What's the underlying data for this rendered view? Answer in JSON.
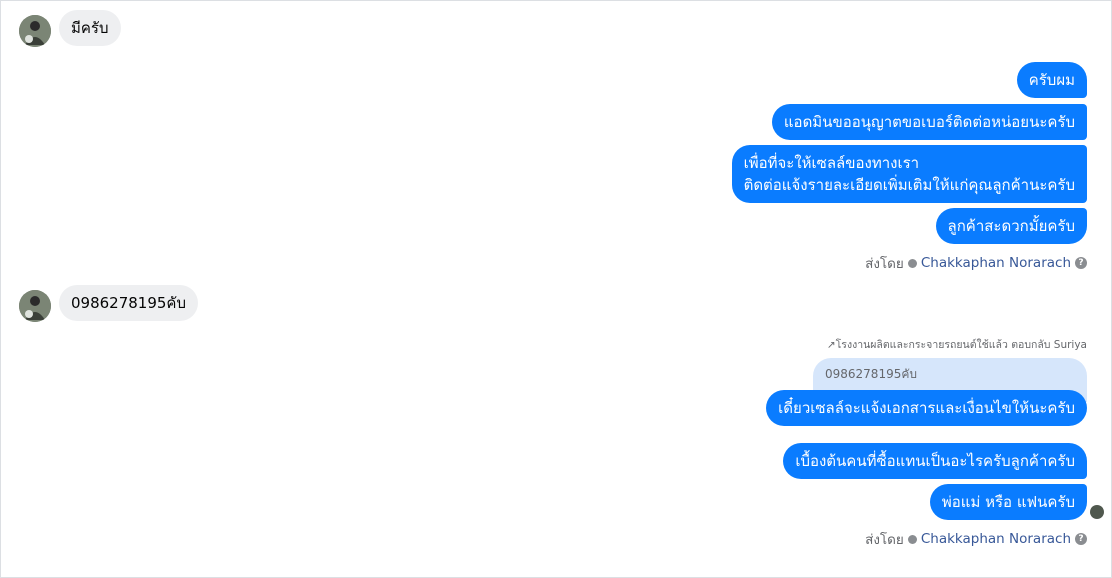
{
  "messages": {
    "incoming_1": "มีครับ",
    "outgoing_group_1": [
      "ครับผม",
      "แอดมินขออนุญาตขอเบอร์ติดต่อหน่อยนะครับ",
      "เพื่อที่จะให้เซลล์ของทางเรา",
      "ติดต่อแจ้งรายละเอียดเพิ่มเติมให้แก่คุณลูกค้านะครับ",
      "ลูกค้าสะดวกมั้ยครับ"
    ],
    "incoming_2": "0986278195คับ",
    "reply": {
      "label": "โรงงานผลิตและกระจายรถยนต์ใช้แล้ว ตอบกลับ Suriya",
      "quoted_text": "0986278195คับ",
      "text": "เดี๋ยวเซลล์จะแจ้งเอกสารและเงื่อนไขให้นะครับ"
    },
    "outgoing_group_2": [
      "เบื้องต้นคนที่ซื้อแทนเป็นอะไรครับลูกค้าครับ",
      "พ่อแม่ หรือ แฟนครับ"
    ]
  },
  "sent_by": {
    "prefix": "ส่งโดย",
    "name": "Chakkaphan Norarach",
    "help_icon": "?"
  },
  "colors": {
    "outgoing_bubble": "#0a7cff",
    "incoming_bubble": "#eeeff1",
    "quoted_bubble": "#d6e6fb",
    "sender_link": "#385898"
  },
  "icons": [
    "avatar",
    "verified-check-icon",
    "help-icon",
    "reply-arrow-icon",
    "seen-avatar"
  ]
}
